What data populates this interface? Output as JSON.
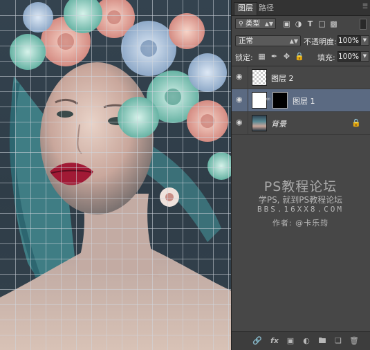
{
  "tabs": {
    "layers": "图层",
    "paths": "路径"
  },
  "filter": {
    "kind_label": "类型",
    "filter_icons": [
      "image-filter-icon",
      "adjustment-filter-icon",
      "type-filter-icon",
      "shape-filter-icon",
      "smart-object-filter-icon"
    ]
  },
  "blend": {
    "mode": "正常",
    "opacity_label": "不透明度:",
    "opacity_value": "100%"
  },
  "lock": {
    "label": "锁定:",
    "fill_label": "填充:",
    "fill_value": "100%",
    "lock_icons": [
      "lock-transparent-icon",
      "lock-image-icon",
      "lock-position-icon",
      "lock-all-icon"
    ]
  },
  "layers": [
    {
      "name": "图层 2",
      "thumb": "transparent",
      "selected": false,
      "italic": false,
      "locked": false
    },
    {
      "name": "图层 1",
      "thumb": "white",
      "mask": true,
      "selected": true,
      "italic": false,
      "locked": false
    },
    {
      "name": "背景",
      "thumb": "photo",
      "selected": false,
      "italic": true,
      "locked": true
    }
  ],
  "bottom_icons": [
    "link-layers-icon",
    "fx-icon",
    "add-mask-icon",
    "adjustment-layer-icon",
    "group-icon",
    "new-layer-icon",
    "delete-icon"
  ],
  "watermark": {
    "title": "PS教程论坛",
    "line2": "学PS, 就到PS教程论坛",
    "url": "BBS.16XX8.COM",
    "author": "作者: @卡乐筠"
  },
  "colors": {
    "panel_bg": "#454545",
    "selected_layer": "#5b6a82",
    "canvas_bg": "#34434f"
  }
}
